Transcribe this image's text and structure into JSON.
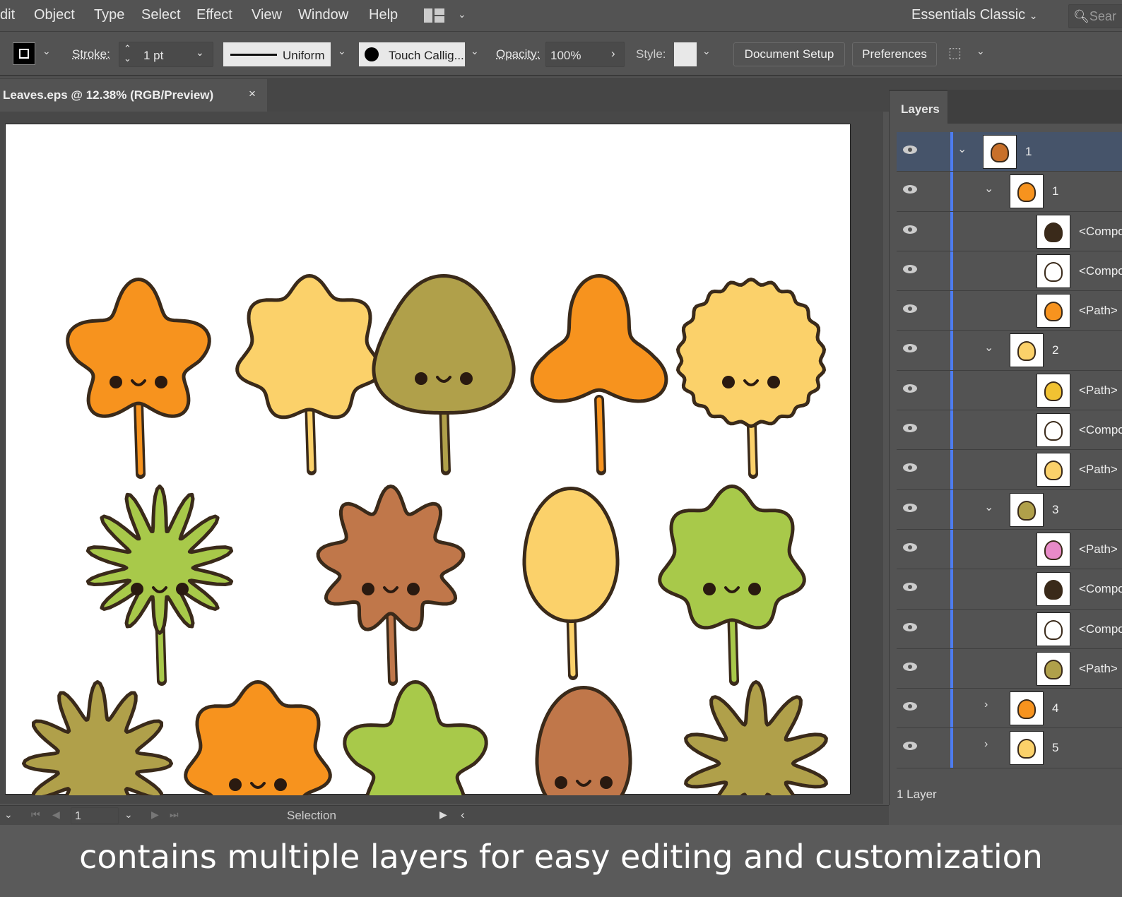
{
  "menu": [
    "dit",
    "Object",
    "Type",
    "Select",
    "Effect",
    "View",
    "Window",
    "Help"
  ],
  "workspace": "Essentials Classic",
  "search_placeholder": "Sear",
  "toolbar": {
    "stroke_label": "Stroke:",
    "stroke_value": "1 pt",
    "profile": "Uniform",
    "brush": "Touch Callig...",
    "opacity_label": "Opacity:",
    "opacity_value": "100%",
    "style_label": "Style:",
    "document_setup": "Document Setup",
    "preferences": "Preferences"
  },
  "doc_tab": {
    "title": "Leaves.eps @ 12.38% (RGB/Preview)",
    "close": "×"
  },
  "layers_panel": {
    "tab": "Layers",
    "count": "1 Layer",
    "rows": [
      {
        "label": "1",
        "level": 0,
        "toggle": "expanded",
        "thumb": "#c8702a",
        "selected": true
      },
      {
        "label": "1",
        "level": 1,
        "toggle": "expanded",
        "thumb": "#f7931e"
      },
      {
        "label": "<Compo",
        "level": 2,
        "toggle": "none",
        "thumb": "#3a2a1a"
      },
      {
        "label": "<Compo",
        "level": 2,
        "toggle": "none",
        "thumb": "#ffffff"
      },
      {
        "label": "<Path>",
        "level": 2,
        "toggle": "none",
        "thumb": "#f7931e"
      },
      {
        "label": "2",
        "level": 1,
        "toggle": "expanded",
        "thumb": "#fbd16a"
      },
      {
        "label": "<Path>",
        "level": 2,
        "toggle": "none",
        "thumb": "#f1c232"
      },
      {
        "label": "<Compo",
        "level": 2,
        "toggle": "none",
        "thumb": "#ffffff"
      },
      {
        "label": "<Path>",
        "level": 2,
        "toggle": "none",
        "thumb": "#fbd16a"
      },
      {
        "label": "3",
        "level": 1,
        "toggle": "expanded",
        "thumb": "#b0a04a"
      },
      {
        "label": "<Path>",
        "level": 2,
        "toggle": "none",
        "thumb": "#e88ac8"
      },
      {
        "label": "<Compo",
        "level": 2,
        "toggle": "none",
        "thumb": "#3a2a1a"
      },
      {
        "label": "<Compo",
        "level": 2,
        "toggle": "none",
        "thumb": "#ffffff"
      },
      {
        "label": "<Path>",
        "level": 2,
        "toggle": "none",
        "thumb": "#b0a04a"
      },
      {
        "label": "4",
        "level": 1,
        "toggle": "collapsed",
        "thumb": "#f7931e"
      },
      {
        "label": "5",
        "level": 1,
        "toggle": "collapsed",
        "thumb": "#fbd16a"
      }
    ]
  },
  "status": {
    "page": "1",
    "tool": "Selection"
  },
  "caption": "contains multiple layers for easy editing and customization",
  "artwork": {
    "leaves": [
      {
        "color": "#f7931e",
        "lobes": 5,
        "depth": 0.35,
        "face": true
      },
      {
        "color": "#fbd16a",
        "lobes": 7,
        "depth": 0.2,
        "face": false
      },
      {
        "color": "#b0a04a",
        "lobes": 3,
        "depth": 0.15,
        "face": true
      },
      {
        "color": "#f7931e",
        "lobes": 3,
        "depth": 0.5,
        "face": false
      },
      {
        "color": "#fbd16a",
        "lobes": 22,
        "depth": 0.06,
        "face": true
      },
      {
        "color": "#a8c94a",
        "lobes": 14,
        "depth": 0.55,
        "face": true
      },
      {
        "color": "#c0774a",
        "lobes": 9,
        "depth": 0.3,
        "face": true
      },
      {
        "color": "#fbd16a",
        "lobes": 1,
        "depth": 0,
        "face": false
      },
      {
        "color": "#a8c94a",
        "lobes": 7,
        "depth": 0.2,
        "face": true
      },
      {
        "color": "#b0a04a",
        "lobes": 12,
        "depth": 0.45,
        "face": false
      },
      {
        "color": "#f7931e",
        "lobes": 7,
        "depth": 0.2,
        "face": true
      },
      {
        "color": "#a8c94a",
        "lobes": 5,
        "depth": 0.4,
        "face": false
      },
      {
        "color": "#c0774a",
        "lobes": 1,
        "depth": 0,
        "face": true
      },
      {
        "color": "#b0a04a",
        "lobes": 10,
        "depth": 0.5,
        "face": false
      }
    ]
  }
}
